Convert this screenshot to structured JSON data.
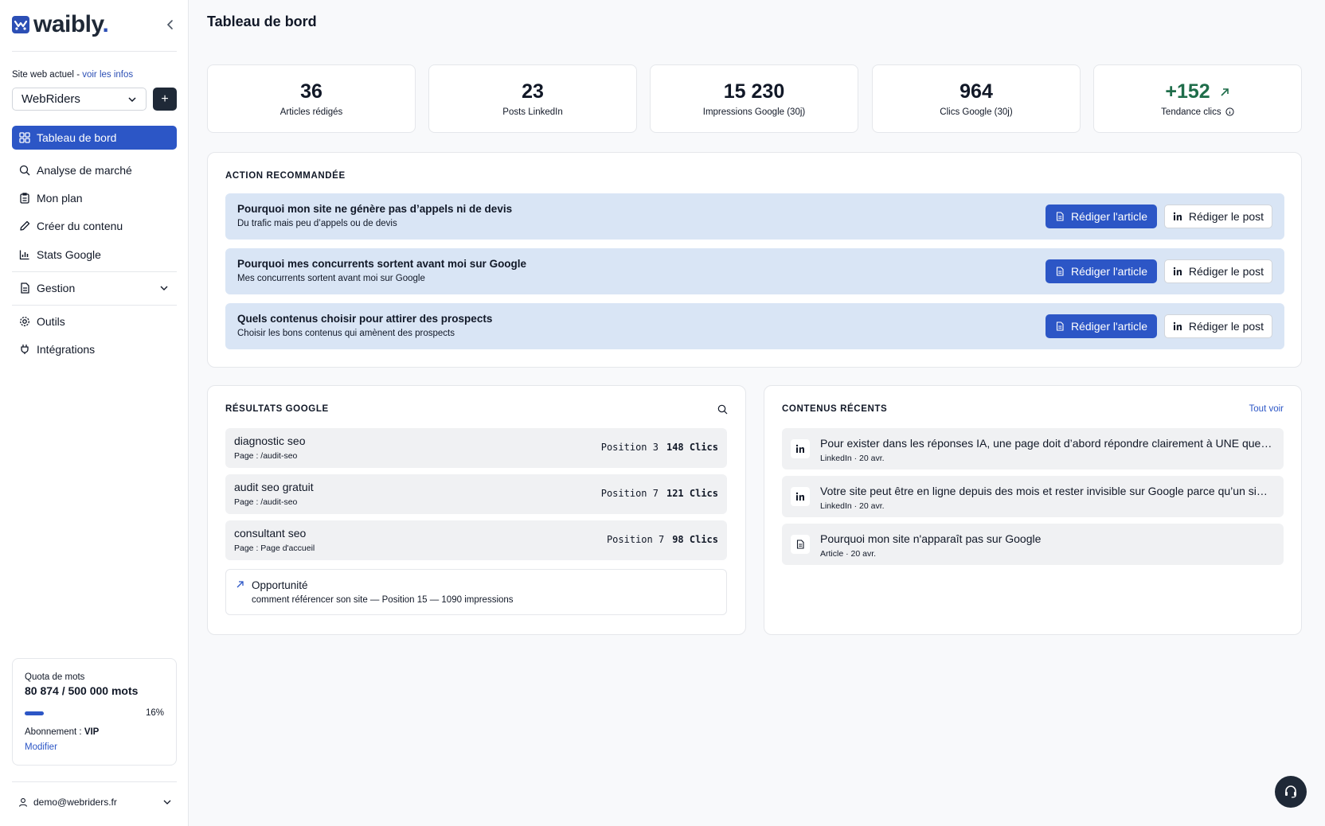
{
  "brand": {
    "name": "waibly",
    "dot": "."
  },
  "sidebar": {
    "site_label": "Site web actuel",
    "site_sep": " - ",
    "site_link": "voir les infos",
    "site_value": "WebRiders",
    "add_label": "+",
    "items": [
      {
        "label": "Tableau de bord",
        "icon": "dashboard-icon"
      },
      {
        "label": "Analyse de marché",
        "icon": "search-icon"
      },
      {
        "label": "Mon plan",
        "icon": "clipboard-icon"
      },
      {
        "label": "Créer du contenu",
        "icon": "pencil-icon"
      },
      {
        "label": "Stats Google",
        "icon": "bar-chart-icon"
      },
      {
        "label": "Gestion",
        "icon": "document-icon"
      },
      {
        "label": "Outils",
        "icon": "gear-icon"
      },
      {
        "label": "Intégrations",
        "icon": "plug-icon"
      }
    ],
    "quota": {
      "title": "Quota de mots",
      "value": "80 874 / 500 000 mots",
      "percent_label": "16%",
      "progress": 0.16,
      "subscription_label": "Abonnement : ",
      "subscription_value": "VIP",
      "modify": "Modifier"
    },
    "user_email": "demo@webriders.fr"
  },
  "page_title": "Tableau de bord",
  "stats": [
    {
      "value": "36",
      "label": "Articles rédigés"
    },
    {
      "value": "23",
      "label": "Posts LinkedIn"
    },
    {
      "value": "15 230",
      "label": "Impressions Google (30j)"
    },
    {
      "value": "964",
      "label": "Clics Google (30j)"
    },
    {
      "value": "+152",
      "label": "Tendance clics"
    }
  ],
  "actions": {
    "title": "ACTION RECOMMANDÉE",
    "article_btn": "Rédiger l'article",
    "post_btn": "Rédiger le post",
    "items": [
      {
        "title": "Pourquoi mon site ne génère pas d’appels ni de devis",
        "subtitle": "Du trafic mais peu d’appels ou de devis"
      },
      {
        "title": "Pourquoi mes concurrents sortent avant moi sur Google",
        "subtitle": "Mes concurrents sortent avant moi sur Google"
      },
      {
        "title": "Quels contenus choisir pour attirer des prospects",
        "subtitle": "Choisir les bons contenus qui amènent des prospects"
      }
    ]
  },
  "google": {
    "title": "RÉSULTATS GOOGLE",
    "rows": [
      {
        "keyword": "diagnostic seo",
        "page": "Page : /audit-seo",
        "position": "Position 3",
        "clicks": "148 Clics"
      },
      {
        "keyword": "audit seo gratuit",
        "page": "Page : /audit-seo",
        "position": "Position 7",
        "clicks": "121 Clics"
      },
      {
        "keyword": "consultant seo",
        "page": "Page : Page d'accueil",
        "position": "Position 7",
        "clicks": "98 Clics"
      }
    ],
    "opportunity": {
      "title": "Opportunité",
      "keyword": "comment référencer son site",
      "detail": " — Position 15 — 1090 impressions"
    }
  },
  "recent": {
    "title": "CONTENUS RÉCENTS",
    "see_all": "Tout voir",
    "items": [
      {
        "title": "Pour exister dans les réponses IA, une page doit d’abord répondre clairement à UNE questi...",
        "meta": "LinkedIn · 20 avr.",
        "icon": "linkedin-icon"
      },
      {
        "title": "Votre site peut être en ligne depuis des mois et rester invisible sur Google parce qu’un sim...",
        "meta": "LinkedIn · 20 avr.",
        "icon": "linkedin-icon"
      },
      {
        "title": "Pourquoi mon site n'apparaît pas sur Google",
        "meta": "Article · 20 avr.",
        "icon": "document-icon"
      }
    ]
  },
  "colors": {
    "accent": "#2c56c6",
    "trend": "#1f6d4a",
    "action_bg": "#d9e5f5"
  }
}
